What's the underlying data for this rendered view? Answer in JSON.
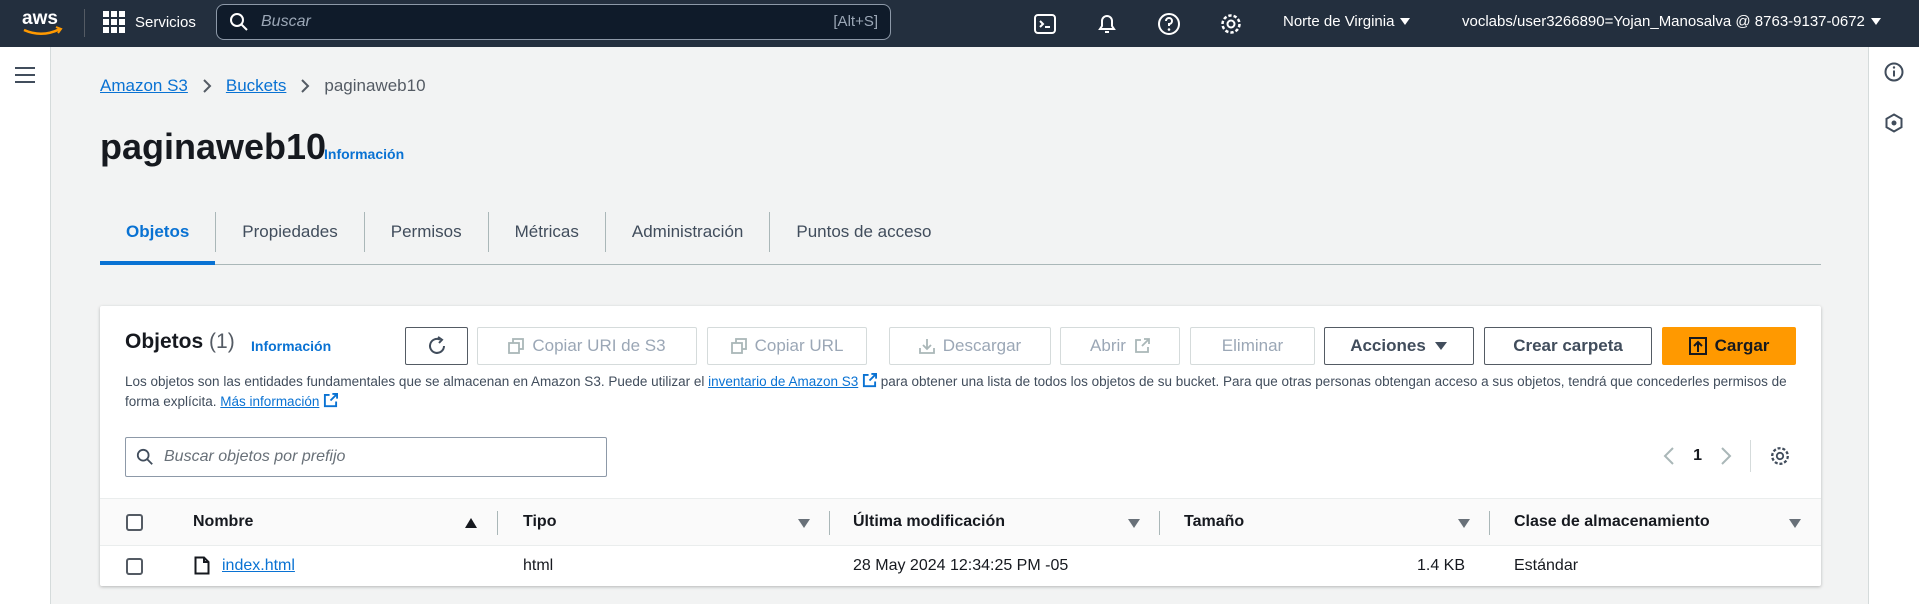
{
  "topbar": {
    "logo_text": "aws",
    "services_label": "Servicios",
    "search_placeholder": "Buscar",
    "search_shortcut": "[Alt+S]",
    "region": "Norte de Virginia",
    "account": "voclabs/user3266890=Yojan_Manosalva @ 8763-9137-0672",
    "icons": [
      "cloudshell-icon",
      "bell-icon",
      "help-icon",
      "settings-icon"
    ]
  },
  "breadcrumb": {
    "items": [
      "Amazon S3",
      "Buckets"
    ],
    "current": "paginaweb10"
  },
  "page": {
    "title": "paginaweb10",
    "info_label": "Información"
  },
  "tabs": [
    "Objetos",
    "Propiedades",
    "Permisos",
    "Métricas",
    "Administración",
    "Puntos de acceso"
  ],
  "objects_panel": {
    "title": "Objetos",
    "count": "(1)",
    "info_label": "Información",
    "buttons": {
      "copy_uri": "Copiar URI de S3",
      "copy_url": "Copiar URL",
      "download": "Descargar",
      "open": "Abrir",
      "delete": "Eliminar",
      "actions": "Acciones",
      "create_folder": "Crear carpeta",
      "upload": "Cargar"
    },
    "description_1": "Los objetos son las entidades fundamentales que se almacenan en Amazon S3. Puede utilizar el ",
    "description_link": "inventario de Amazon S3",
    "description_2": " para obtener una lista de todos los objetos de su bucket. Para que otras personas obtengan acceso a sus objetos, tendrá que concederles permisos de forma explícita. ",
    "more_info_link": "Más información",
    "search_placeholder": "Buscar objetos por prefijo",
    "page_number": "1",
    "columns": [
      "Nombre",
      "Tipo",
      "Última modificación",
      "Tamaño",
      "Clase de almacenamiento"
    ],
    "rows": [
      {
        "name": "index.html",
        "type": "html",
        "modified": "28 May 2024 12:34:25 PM -05",
        "size": "1.4 KB",
        "storage_class": "Estándar"
      }
    ]
  },
  "colors": {
    "topbar": "#232f3e",
    "link": "#0972d3",
    "primary": "#ff9900"
  }
}
